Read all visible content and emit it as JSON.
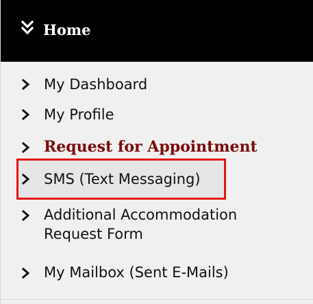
{
  "header": {
    "icon": "double-chevron-down-icon",
    "title": "Home"
  },
  "menu": {
    "item_icon": "chevron-right-icon",
    "items": [
      {
        "label": "My Dashboard"
      },
      {
        "label": "My Profile"
      },
      {
        "label": "Request for Appointment",
        "style": "bold-maroon"
      },
      {
        "label": "SMS (Text Messaging)",
        "highlighted": true
      },
      {
        "label_line1": "Additional Accommodation",
        "label_line2": "Request Form"
      },
      {
        "label": "My Mailbox (Sent E-Mails)"
      }
    ]
  },
  "colors": {
    "header_bg": "#000000",
    "panel_bg": "#f0f0f0",
    "active_text": "#7a0a0a",
    "highlight_border": "#e41414"
  }
}
